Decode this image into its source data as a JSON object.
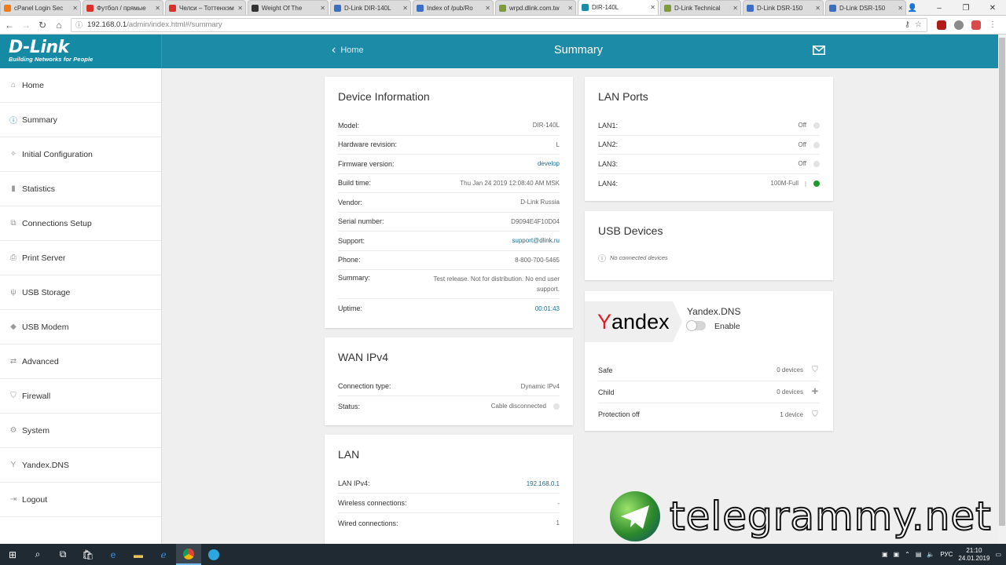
{
  "browser": {
    "tabs": [
      {
        "title": "cPanel Login Sec",
        "color": "#f07b1d"
      },
      {
        "title": "Футбол / прямые",
        "color": "#d9312b"
      },
      {
        "title": "Челси – Тоттенхэм",
        "color": "#d9312b"
      },
      {
        "title": "Weight Of The",
        "color": "#333333"
      },
      {
        "title": "D-Link DIR-140L",
        "color": "#3a6fc4"
      },
      {
        "title": "Index of /pub/Ro",
        "color": "#3a6fc4"
      },
      {
        "title": "wrpd.dlink.com.tw",
        "color": "#7d9c3a"
      },
      {
        "title": "DIR-140L",
        "color": "#1b8ba7"
      },
      {
        "title": "D-Link Technical",
        "color": "#7d9c3a"
      },
      {
        "title": "D-Link DSR-150",
        "color": "#3a6fc4"
      },
      {
        "title": "D-Link DSR-150",
        "color": "#3a6fc4"
      }
    ],
    "active_tab_index": 7,
    "url_host": "192.168.0.1",
    "url_path": "/admin/index.html#/summary"
  },
  "header": {
    "logo_main": "D-Link",
    "logo_sub": "Building Networks for People",
    "home_label": "Home",
    "title": "Summary"
  },
  "sidebar": {
    "items": [
      {
        "label": "Home",
        "icon": "home-icon",
        "glyph": "⌂"
      },
      {
        "label": "Summary",
        "icon": "info-icon",
        "glyph": "ⓘ"
      },
      {
        "label": "Initial Configuration",
        "icon": "wand-icon",
        "glyph": "✧"
      },
      {
        "label": "Statistics",
        "icon": "chart-icon",
        "glyph": "▮"
      },
      {
        "label": "Connections Setup",
        "icon": "connections-icon",
        "glyph": "⧉"
      },
      {
        "label": "Print Server",
        "icon": "printer-icon",
        "glyph": "⎙"
      },
      {
        "label": "USB Storage",
        "icon": "usb-icon",
        "glyph": "ψ"
      },
      {
        "label": "USB Modem",
        "icon": "modem-icon",
        "glyph": "◆"
      },
      {
        "label": "Advanced",
        "icon": "advanced-icon",
        "glyph": "⇄"
      },
      {
        "label": "Firewall",
        "icon": "shield-icon",
        "glyph": "⛉"
      },
      {
        "label": "System",
        "icon": "gear-icon",
        "glyph": "⚙"
      },
      {
        "label": "Yandex.DNS",
        "icon": "yandex-icon",
        "glyph": "Y"
      },
      {
        "label": "Logout",
        "icon": "logout-icon",
        "glyph": "⇥"
      }
    ],
    "active_index": 1
  },
  "device_info": {
    "title": "Device Information",
    "rows": [
      {
        "label": "Model:",
        "value": "DIR-140L",
        "link": false
      },
      {
        "label": "Hardware revision:",
        "value": "L",
        "link": false
      },
      {
        "label": "Firmware version:",
        "value": "develop",
        "link": true
      },
      {
        "label": "Build time:",
        "value": "Thu Jan 24 2019 12:08:40 AM MSK",
        "link": false
      },
      {
        "label": "Vendor:",
        "value": "D-Link Russia",
        "link": false
      },
      {
        "label": "Serial number:",
        "value": "D9094E4F10D04",
        "link": false
      },
      {
        "label": "Support:",
        "value": "support@dlink.ru",
        "link": true
      },
      {
        "label": "Phone:",
        "value": "8-800-700-5465",
        "link": false
      },
      {
        "label": "Summary:",
        "value": "Test release. Not for distribution. No end user support.",
        "link": false
      },
      {
        "label": "Uptime:",
        "value": "00:01:43",
        "link": true
      }
    ]
  },
  "wan": {
    "title": "WAN IPv4",
    "rows": [
      {
        "label": "Connection type:",
        "value": "Dynamic IPv4"
      },
      {
        "label": "Status:",
        "value": "Cable disconnected"
      }
    ]
  },
  "lan": {
    "title": "LAN",
    "rows": [
      {
        "label": "LAN IPv4:",
        "value": "192.168.0.1",
        "link": true
      },
      {
        "label": "Wireless connections:",
        "value": "-",
        "link": false
      },
      {
        "label": "Wired connections:",
        "value": "1",
        "link": false
      }
    ]
  },
  "lan_ports": {
    "title": "LAN Ports",
    "ports": [
      {
        "label": "LAN1:",
        "value": "Off",
        "up": false
      },
      {
        "label": "LAN2:",
        "value": "Off",
        "up": false
      },
      {
        "label": "LAN3:",
        "value": "Off",
        "up": false
      },
      {
        "label": "LAN4:",
        "value": "100M-Full",
        "up": true
      }
    ],
    "up_color": "#1d9a2b"
  },
  "usb": {
    "title": "USB Devices",
    "empty_text": "No connected devices"
  },
  "yandex": {
    "logo": "Yandex",
    "name": "Yandex.DNS",
    "toggle_label": "Enable",
    "rows": [
      {
        "label": "Safe",
        "value": "0 devices",
        "icon": "shield-check-icon",
        "glyph": "⛉"
      },
      {
        "label": "Child",
        "value": "0 devices",
        "icon": "child-icon",
        "glyph": "✚"
      },
      {
        "label": "Protection off",
        "value": "1 device",
        "icon": "shield-off-icon",
        "glyph": "⛉"
      }
    ]
  },
  "watermark": {
    "text": "telegrammy.net"
  },
  "taskbar": {
    "lang": "РУС",
    "time": "21:10",
    "date": "24.01.2019"
  }
}
